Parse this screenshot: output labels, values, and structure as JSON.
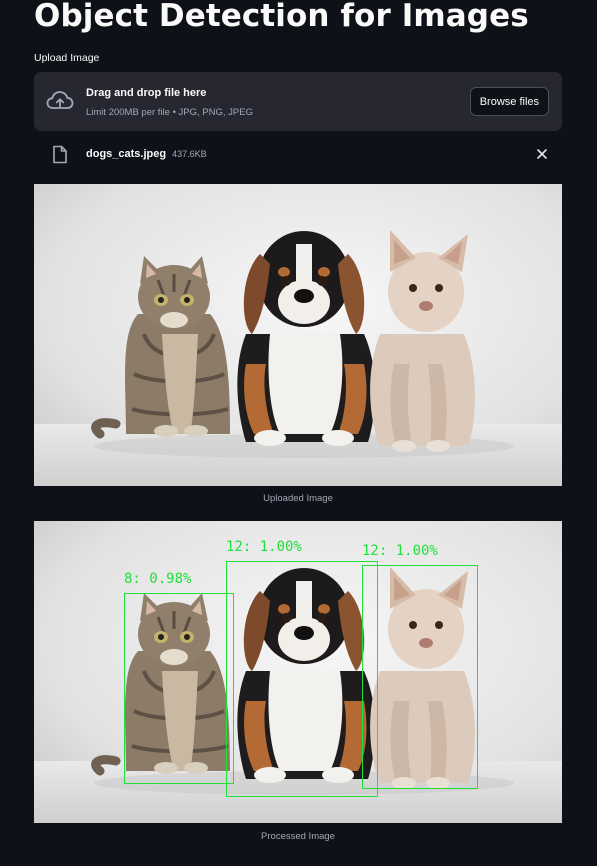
{
  "page": {
    "title": "Object Detection for Images"
  },
  "uploader": {
    "label": "Upload Image",
    "drop_text": "Drag and drop file here",
    "limit_text": "Limit 200MB per file • JPG, PNG, JPEG",
    "browse_label": "Browse files"
  },
  "file": {
    "name": "dogs_cats.jpeg",
    "size": "437.6KB"
  },
  "uploaded_caption": "Uploaded Image",
  "processed_caption": "Processed Image",
  "detections": [
    {
      "label": "8: 0.98%"
    },
    {
      "label": "12: 1.00%"
    },
    {
      "label": "12: 1.00%"
    }
  ],
  "colors": {
    "background": "#0e1117",
    "panel": "#262730",
    "box": "#22e03a"
  },
  "icons": [
    "cloud-upload-icon",
    "file-icon",
    "close-icon"
  ]
}
